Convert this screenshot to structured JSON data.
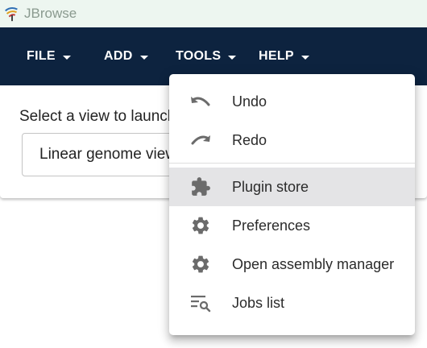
{
  "window": {
    "title": "JBrowse"
  },
  "appbar": {
    "menus": [
      {
        "label": "FILE"
      },
      {
        "label": "ADD"
      },
      {
        "label": "TOOLS"
      },
      {
        "label": "HELP"
      }
    ]
  },
  "launch": {
    "prompt": "Select a view to launch",
    "selected_view": "Linear genome view"
  },
  "tools_menu": {
    "items": [
      {
        "label": "Undo",
        "icon": "undo-icon"
      },
      {
        "label": "Redo",
        "icon": "redo-icon"
      },
      {
        "label": "Plugin store",
        "icon": "puzzle-icon",
        "hovered": true
      },
      {
        "label": "Preferences",
        "icon": "gear-icon"
      },
      {
        "label": "Open assembly manager",
        "icon": "gear-icon"
      },
      {
        "label": "Jobs list",
        "icon": "list-search-icon"
      }
    ]
  },
  "colors": {
    "appbar": "#0d233f",
    "titlebar": "#edf6f0",
    "hover": "#e4e4e6",
    "icon": "#6b6b6b"
  }
}
